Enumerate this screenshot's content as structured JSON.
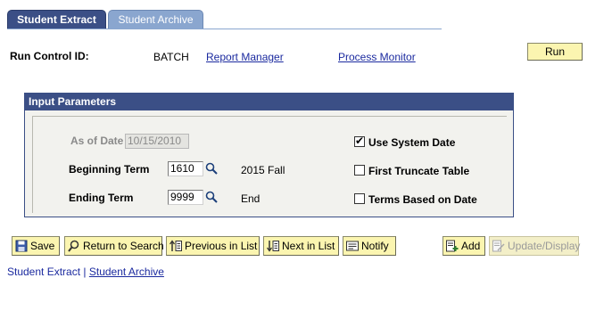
{
  "tabs": [
    {
      "label": "Student Extract",
      "active": true
    },
    {
      "label": "Student Archive",
      "active": false
    }
  ],
  "header": {
    "run_control_label": "Run Control ID:",
    "run_control_value": "BATCH",
    "report_manager": "Report Manager",
    "process_monitor": "Process Monitor",
    "run_button": "Run"
  },
  "params": {
    "title": "Input Parameters",
    "as_of_date_label": "As of Date",
    "as_of_date_value": "10/15/2010",
    "beginning_term_label": "Beginning Term",
    "beginning_term_value": "1610",
    "beginning_term_desc": "2015 Fall",
    "ending_term_label": "Ending Term",
    "ending_term_value": "9999",
    "ending_term_desc": "End",
    "use_system_date_label": "Use System Date",
    "use_system_date_checked": true,
    "first_truncate_label": "First Truncate Table",
    "first_truncate_checked": false,
    "terms_based_label": "Terms Based on Date",
    "terms_based_checked": false
  },
  "toolbar": {
    "save": "Save",
    "return_to_search": "Return to Search",
    "previous_in_list": "Previous in List",
    "next_in_list": "Next in List",
    "notify": "Notify",
    "add": "Add",
    "update_display": "Update/Display"
  },
  "footer_links": {
    "student_extract": "Student Extract",
    "separator": "|",
    "student_archive": "Student Archive"
  },
  "colors": {
    "tab_active": "#3b4f86",
    "tab_inactive": "#8aa6cf",
    "button_bg": "#fbf5b0",
    "link": "#1b2a9f"
  }
}
